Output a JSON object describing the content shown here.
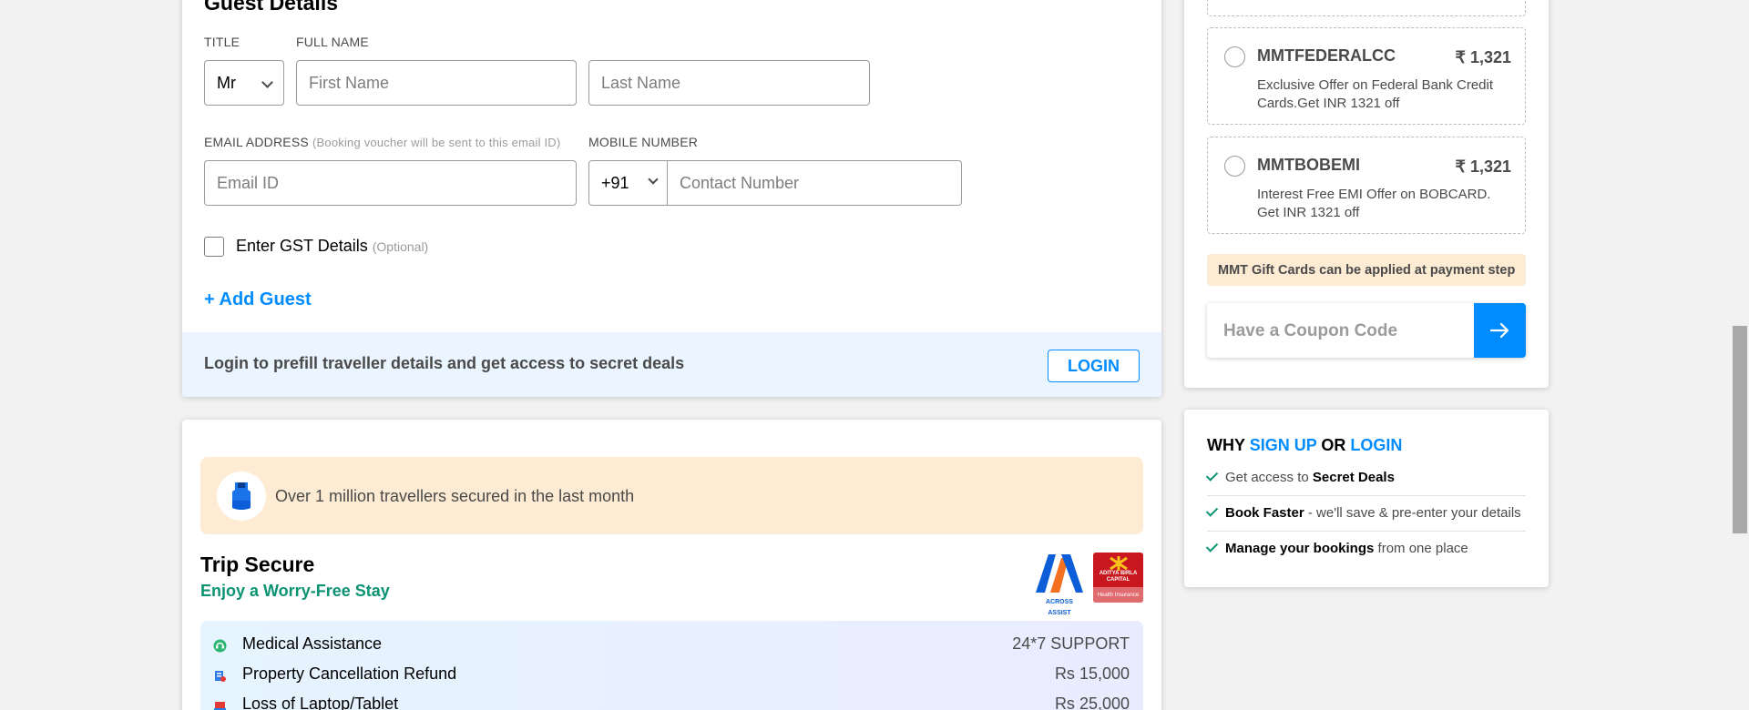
{
  "guest_details": {
    "title": "Guest Details",
    "title_label": "TITLE",
    "full_name_label": "FULL NAME",
    "title_value": "Mr",
    "first_name_placeholder": "First Name",
    "last_name_placeholder": "Last Name",
    "email_label": "EMAIL ADDRESS",
    "email_note": "(Booking voucher will be sent to this email ID)",
    "mobile_label": "MOBILE NUMBER",
    "email_placeholder": "Email ID",
    "country_code": "+91",
    "contact_placeholder": "Contact Number",
    "gst_label": "Enter GST Details",
    "gst_optional": "(Optional)",
    "add_guest": "+ Add Guest",
    "login_prompt": "Login to prefill traveller details and get access to secret deals",
    "login_button": "LOGIN"
  },
  "trip_secure": {
    "banner_text": "Over 1 million travellers secured in the last month",
    "title": "Trip Secure",
    "subtitle": "Enjoy a Worry-Free Stay",
    "logo_across_text": "ACROSS ASSIST",
    "logo_adity_top": "ADITYA BIRLA CAPITAL",
    "logo_adity_bottom": "Health Insurance",
    "benefits": [
      {
        "name": "Medical Assistance",
        "value": "24*7 SUPPORT",
        "icon": "medical-icon"
      },
      {
        "name": "Property Cancellation Refund",
        "value": "Rs 15,000",
        "icon": "refund-icon"
      },
      {
        "name": "Loss of Laptop/Tablet",
        "value": "Rs 25,000",
        "icon": "laptop-icon"
      }
    ]
  },
  "offers": {
    "coupons": [
      {
        "code": "MMTFEDERALCC",
        "amount": "₹ 1,321",
        "desc": "Exclusive Offer on Federal Bank Credit Cards.Get INR 1321 off"
      },
      {
        "code": "MMTBOBEMI",
        "amount": "₹ 1,321",
        "desc": "Interest Free EMI Offer on BOBCARD. Get INR 1321 off"
      }
    ],
    "gift_note": "MMT Gift Cards can be applied at payment step",
    "coupon_placeholder": "Have a Coupon Code"
  },
  "why_signup": {
    "why": "WHY",
    "sign_up": "SIGN UP",
    "or": "OR",
    "login": "LOGIN",
    "items": [
      {
        "pre": "Get access to ",
        "bold": "Secret Deals",
        "post": ""
      },
      {
        "pre": "",
        "bold": "Book Faster",
        "post": " - we'll save & pre-enter your details"
      },
      {
        "pre": "",
        "bold": "Manage your bookings",
        "post": " from one place"
      }
    ]
  },
  "colors": {
    "primary_blue": "#008cff",
    "green": "#0c9373",
    "peach": "#fdebd3"
  }
}
